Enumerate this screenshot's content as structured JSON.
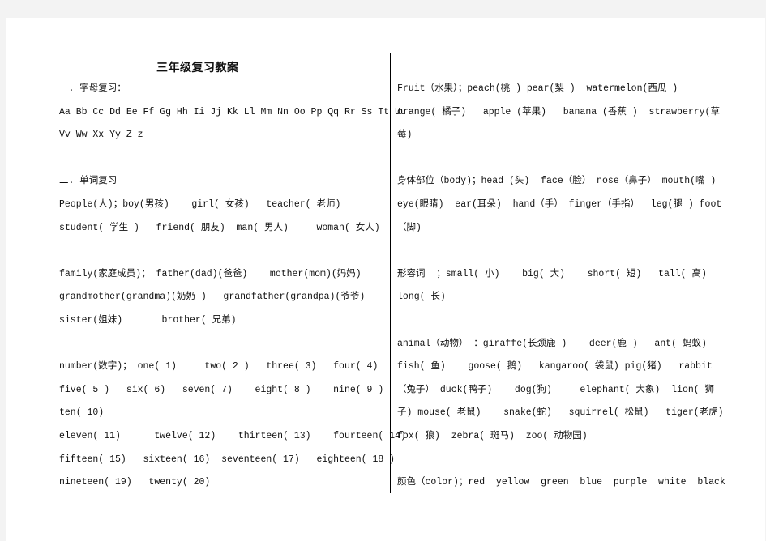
{
  "document": {
    "title": "三年级复习教案",
    "left_column": [
      {
        "text": "一. 字母复习：",
        "top": 0
      },
      {
        "text": "Aa Bb Cc Dd Ee Ff Gg Hh Ii Jj Kk Ll Mm Nn Oo Pp Qq Rr Ss Tt Uu"
      },
      {
        "text": "Vv Ww Xx Yy Z z"
      },
      {
        "text": ""
      },
      {
        "text": "二. 单词复习"
      },
      {
        "text": "People(人)；boy(男孩)    girl( 女孩)   teacher( 老师)"
      },
      {
        "text": "student( 学生 )   friend( 朋友)  man( 男人)     woman( 女人)"
      },
      {
        "text": ""
      },
      {
        "text": "family(家庭成员)； father(dad)(爸爸)    mother(mom)(妈妈)"
      },
      {
        "text": "grandmother(grandma)(奶奶 )   grandfather(grandpa)(爷爷)"
      },
      {
        "text": "sister(姐妹)       brother( 兄弟)"
      },
      {
        "text": ""
      },
      {
        "text": "number(数字)； one( 1)     two( 2 )   three( 3)   four( 4)"
      },
      {
        "text": "five( 5 )   six( 6)   seven( 7)    eight( 8 )    nine( 9 )"
      },
      {
        "text": "ten( 10)"
      },
      {
        "text": "eleven( 11)      twelve( 12)    thirteen( 13)    fourteen( 14)"
      },
      {
        "text": "fifteen( 15)   sixteen( 16)  seventeen( 17)   eighteen( 18 )"
      },
      {
        "text": "nineteen( 19)   twenty( 20)"
      }
    ],
    "right_column": [
      {
        "text": "Fruit（水果）；peach(桃 ) pear(梨 )  watermelon(西瓜 )"
      },
      {
        "text": "orange( 橘子)   apple (苹果)   banana (香蕉 )  strawberry(草"
      },
      {
        "text": "莓)"
      },
      {
        "text": ""
      },
      {
        "text": "身体部位（body)；head (头)  face（脸） nose（鼻子） mouth(嘴 )"
      },
      {
        "text": "eye(眼睛)  ear(耳朵)  hand（手） finger（手指）  leg(腿 ) foot"
      },
      {
        "text": "（脚)"
      },
      {
        "text": ""
      },
      {
        "text": "形容词  ；small( 小)    big( 大)    short( 短)   tall( 高)"
      },
      {
        "text": "long( 长)"
      },
      {
        "text": ""
      },
      {
        "text": "animal（动物） ：giraffe(长颈鹿 )    deer(鹿 )   ant( 蚂蚁)"
      },
      {
        "text": "fish( 鱼)    goose( 鹅)   kangaroo( 袋鼠) pig(猪)   rabbit"
      },
      {
        "text": "（兔子） duck(鸭子)    dog(狗)     elephant( 大象)  lion( 狮"
      },
      {
        "text": "子) mouse( 老鼠)    snake(蛇)   squirrel( 松鼠)   tiger(老虎)"
      },
      {
        "text": "fox( 狼)  zebra( 斑马)  zoo( 动物园)"
      },
      {
        "text": ""
      },
      {
        "text": "颜色（color)；red  yellow  green  blue  purple  white  black"
      }
    ]
  }
}
